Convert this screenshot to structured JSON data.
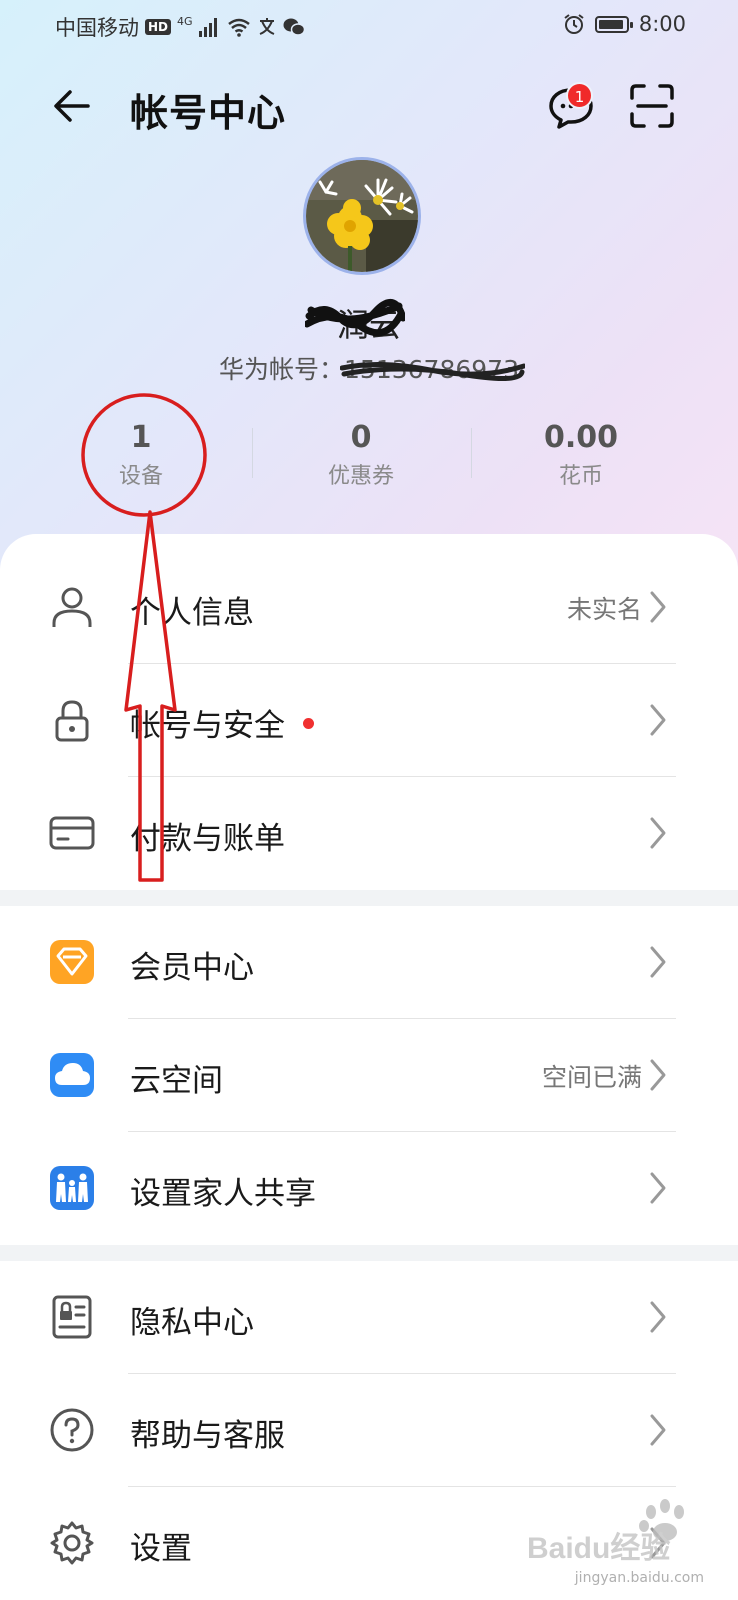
{
  "status_bar": {
    "carrier": "中国移动",
    "hd": "HD",
    "network": "4G",
    "time": "8:00"
  },
  "header": {
    "title": "帐号中心",
    "message_badge": "1"
  },
  "profile": {
    "nickname": "润云",
    "account_label": "华为帐号：",
    "account_value": "15136786973"
  },
  "stats": [
    {
      "value": "1",
      "label": "设备"
    },
    {
      "value": "0",
      "label": "优惠券"
    },
    {
      "value": "0.00",
      "label": "花币"
    }
  ],
  "menu": {
    "group1": [
      {
        "label": "个人信息",
        "value": "未实名",
        "icon": "person-icon"
      },
      {
        "label": "帐号与安全",
        "value": "",
        "icon": "lock-icon",
        "dot": true
      },
      {
        "label": "付款与账单",
        "value": "",
        "icon": "card-icon"
      }
    ],
    "group2": [
      {
        "label": "会员中心",
        "value": "",
        "icon": "member-diamond-icon"
      },
      {
        "label": "云空间",
        "value": "空间已满",
        "icon": "cloud-icon"
      },
      {
        "label": "设置家人共享",
        "value": "",
        "icon": "family-icon"
      }
    ],
    "group3": [
      {
        "label": "隐私中心",
        "value": "",
        "icon": "privacy-icon"
      },
      {
        "label": "帮助与客服",
        "value": "",
        "icon": "help-icon"
      },
      {
        "label": "设置",
        "value": "",
        "icon": "gear-icon"
      }
    ]
  },
  "colors": {
    "accent_red": "#f02a2a",
    "annotation_red": "#d81e1e",
    "member_orange": "#ffa424",
    "cloud_blue": "#2f8cf5"
  },
  "watermark": {
    "logo": "Baidu经验",
    "url": "jingyan.baidu.com"
  }
}
